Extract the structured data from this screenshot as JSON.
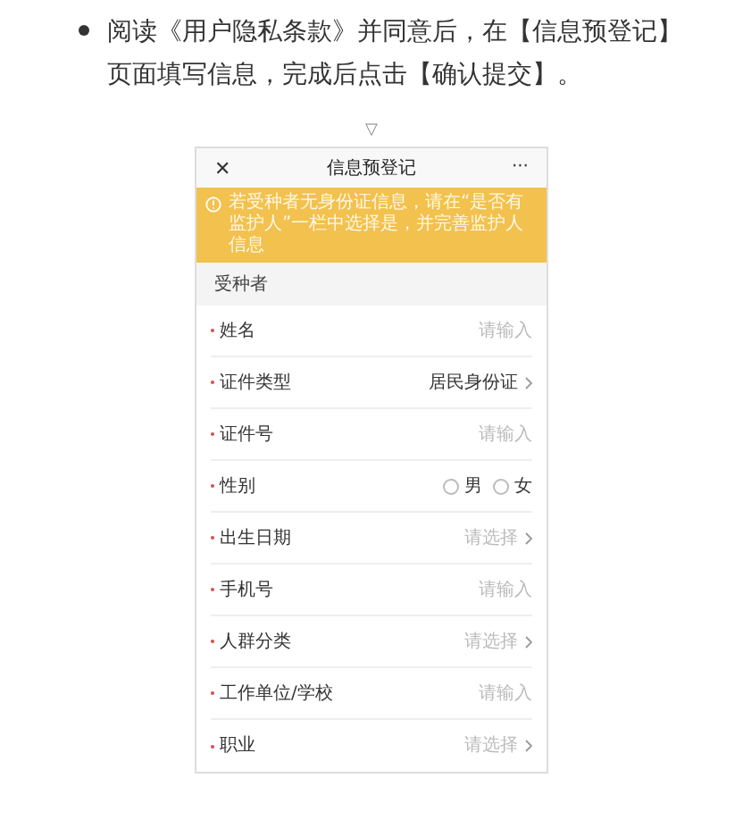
{
  "instruction": "阅读《用户隐私条款》并同意后，在【信息预登记】页面填写信息，完成后点击【确认提交】。",
  "arrow": "▽",
  "phone": {
    "close": "✕",
    "title": "信息预登记",
    "more": "···",
    "notice": "若受种者无身份证信息，请在“是否有监护人”一栏中选择是，并完善监护人信息",
    "section": "受种者",
    "fields": [
      {
        "kind": "input",
        "label": "姓名",
        "required": true,
        "placeholder": "请输入"
      },
      {
        "kind": "select",
        "label": "证件类型",
        "required": true,
        "value": "居民身份证"
      },
      {
        "kind": "input",
        "label": "证件号",
        "required": true,
        "placeholder": "请输入"
      },
      {
        "kind": "radio",
        "label": "性别",
        "required": true,
        "options": [
          {
            "label": "男",
            "selected": false
          },
          {
            "label": "女",
            "selected": false
          }
        ]
      },
      {
        "kind": "select",
        "label": "出生日期",
        "required": true,
        "placeholder": "请选择"
      },
      {
        "kind": "input",
        "label": "手机号",
        "required": true,
        "placeholder": "请输入"
      },
      {
        "kind": "select",
        "label": "人群分类",
        "required": true,
        "placeholder": "请选择"
      },
      {
        "kind": "input",
        "label": "工作单位/学校",
        "required": true,
        "placeholder": "请输入"
      },
      {
        "kind": "select",
        "label": "职业",
        "required": true,
        "placeholder": "请选择"
      }
    ]
  }
}
